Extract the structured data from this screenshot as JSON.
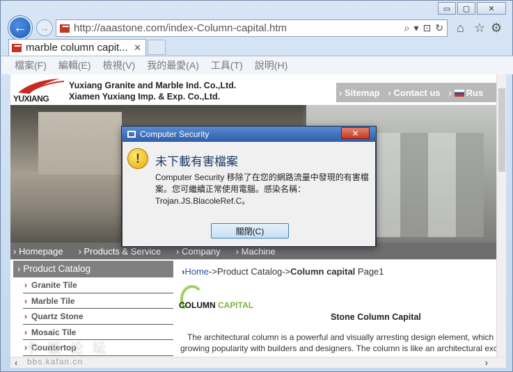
{
  "window": {
    "minimize": "▭",
    "maximize": "▢",
    "close": "✕"
  },
  "browser": {
    "url": "http://aaastone.com/index-Column-capital.htm",
    "tab_title": "marble column capit...",
    "tab_close": "✕",
    "menu": [
      "檔案(F)",
      "編輯(E)",
      "檢視(V)",
      "我的最愛(A)",
      "工具(T)",
      "說明(H)"
    ]
  },
  "site": {
    "logo_text": "YUXIANG",
    "company_line1": "Yuxiang Granite and Marble Ind. Co.,Ltd.",
    "company_line2": "Xiamen Yuxiang Imp. & Exp. Co.,Ltd.",
    "top_nav": [
      "Sitemap",
      "Contact us",
      "Rus"
    ],
    "main_nav": [
      "Homepage",
      "Products & Service",
      "Company",
      "Machine"
    ],
    "catalog_title": "Product Catalog",
    "catalog_items": [
      "Granite Tile",
      "Marble Tile",
      "Quartz Stone",
      "Mosaic Tile",
      "Countertop"
    ],
    "breadcrumb": {
      "home": "Home",
      "sep": "->",
      "catalog": "Product Catalog",
      "current": "Column capital",
      "page": "Page1"
    },
    "column_logo_1": "COLUMN",
    "column_logo_2": "CAPITAL",
    "section_title": "Stone Column Capital",
    "paragraph_line1": "The architectural column is a powerful and visually arresting design element, which",
    "paragraph_line2": "growing popularity with builders and designers. The column is like an architectural exc"
  },
  "watermark": {
    "text": "卡 饭 论 坛",
    "url": "bbs.kafan.cn"
  },
  "dialog": {
    "title": "Computer Security",
    "close": "✕",
    "heading": "未下載有害檔案",
    "message": "Computer Security 移除了在您的網路流量中發現的有害檔案。您可繼續正常使用電腦。感染名稱：Trojan.JS.BlacoleRef.C。",
    "button": "關閉(C)",
    "warning_glyph": "!"
  }
}
